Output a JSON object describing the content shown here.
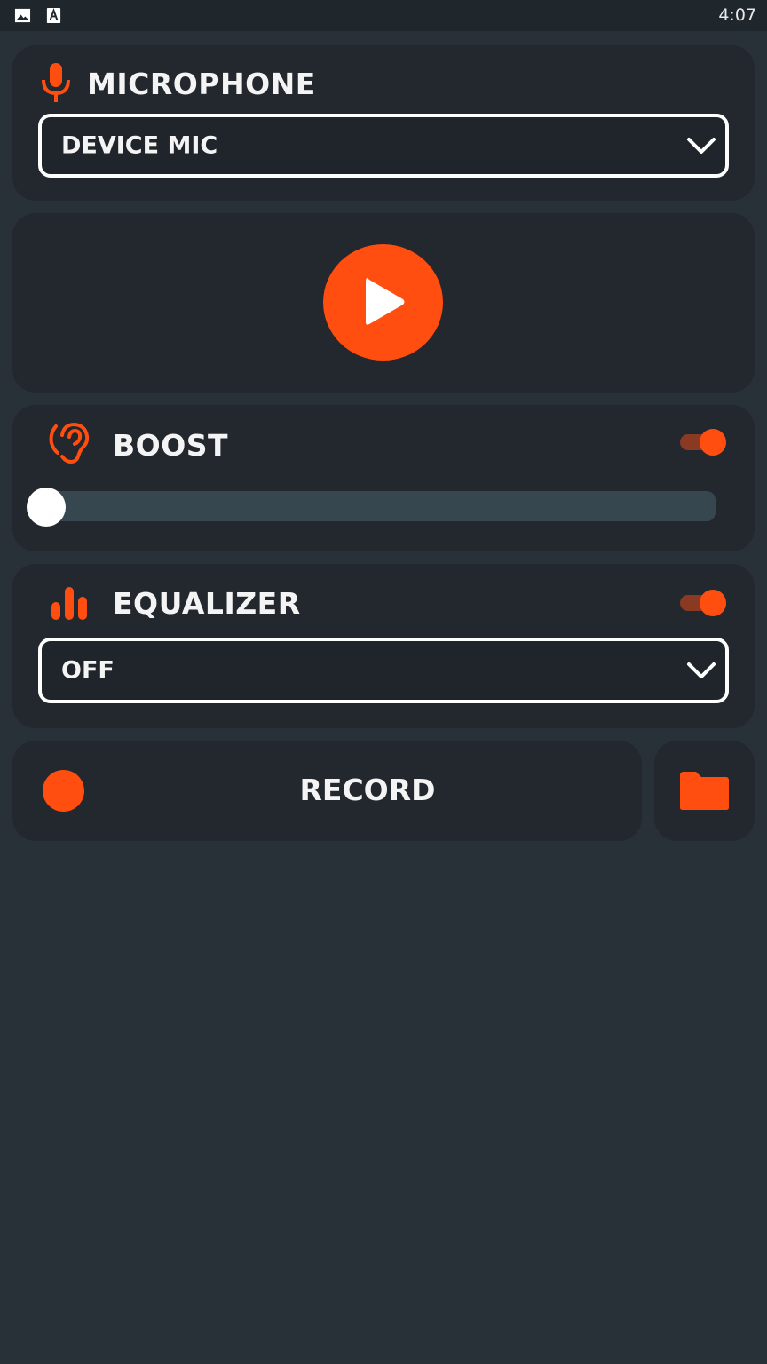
{
  "status_bar": {
    "time": "4:07",
    "icons": [
      "gallery-icon",
      "font-a-icon"
    ]
  },
  "microphone": {
    "title": "MICROPHONE",
    "icon": "microphone-icon",
    "selected_source": "DEVICE MIC"
  },
  "player": {
    "play_icon": "play-icon"
  },
  "boost": {
    "title": "BOOST",
    "icon": "ear-icon",
    "enabled": true,
    "level": 0
  },
  "equalizer": {
    "title": "EQUALIZER",
    "icon": "equalizer-bars-icon",
    "enabled": true,
    "selected_preset": "OFF"
  },
  "record": {
    "label": "RECORD",
    "icon": "record-dot-icon",
    "folder_icon": "folder-icon"
  },
  "colors": {
    "accent": "#ff4e0f",
    "background": "#283038",
    "card": "#22282e",
    "slider_track": "#37474f"
  }
}
